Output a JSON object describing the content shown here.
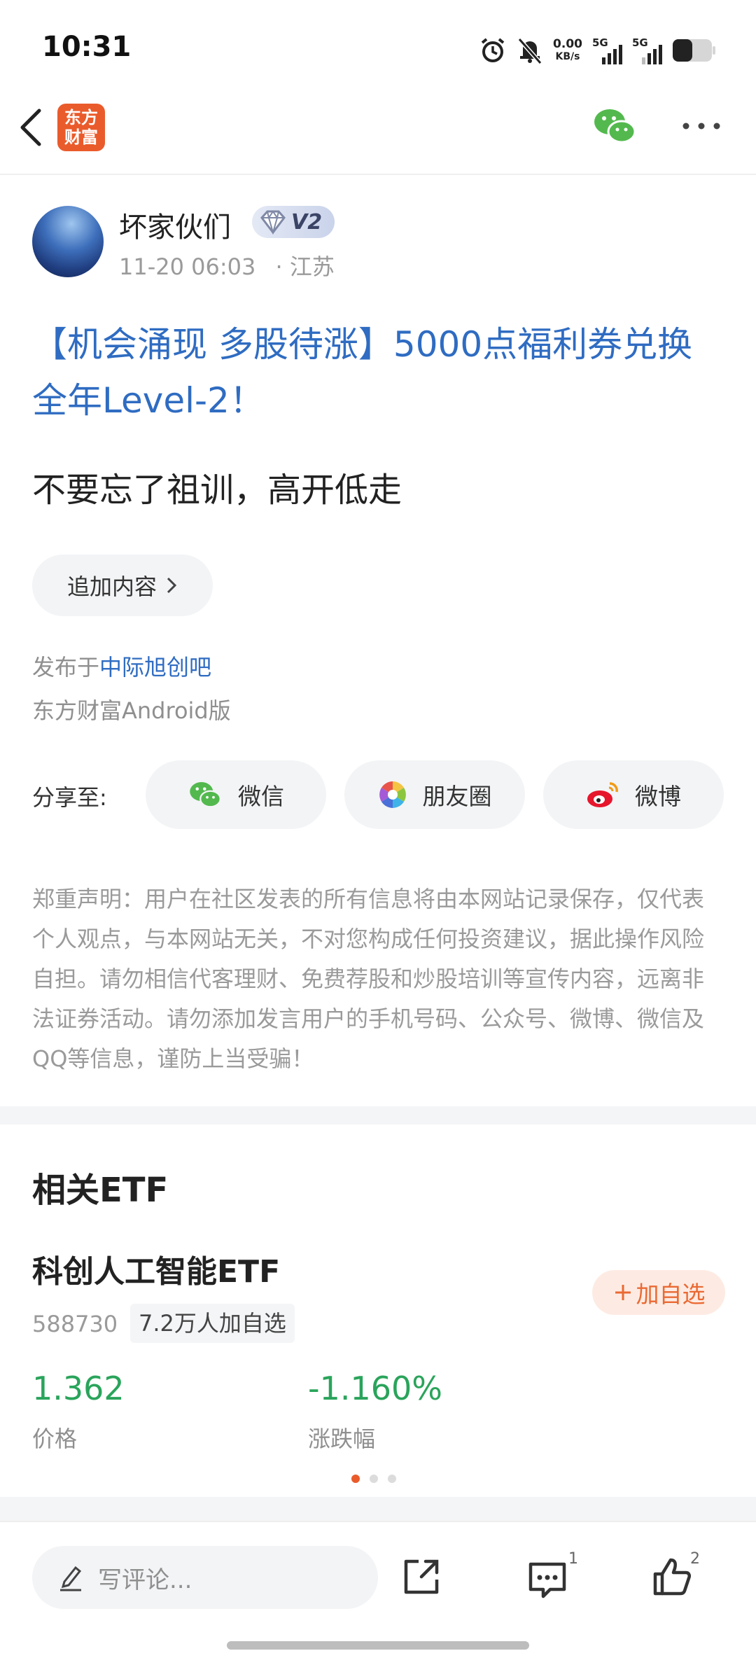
{
  "status_bar": {
    "time": "10:31",
    "net_speed_value": "0.00",
    "net_speed_unit": "KB/s",
    "signal1": "5G",
    "signal2": "5G"
  },
  "header": {
    "logo_text": "东方\n财富"
  },
  "post": {
    "author": "坏家伙们",
    "badge_level": "V2",
    "timestamp": "11-20 06:03",
    "location": "· 江苏",
    "title": "【机会涌现 多股待涨】5000点福利券兑换全年Level-2！",
    "body": "不要忘了祖训，高开低走",
    "append_label": "追加内容",
    "published_prefix": "发布于",
    "forum": "中际旭创吧",
    "client": "东方财富Android版"
  },
  "share": {
    "label": "分享至:",
    "options": [
      {
        "label": "微信",
        "icon": "wechat-icon"
      },
      {
        "label": "朋友圈",
        "icon": "moments-icon"
      },
      {
        "label": "微博",
        "icon": "weibo-icon"
      }
    ]
  },
  "disclaimer": "郑重声明：用户在社区发表的所有信息将由本网站记录保存，仅代表个人观点，与本网站无关，不对您构成任何投资建议，据此操作风险自担。请勿相信代客理财、免费荐股和炒股培训等宣传内容，远离非法证券活动。请勿添加发言用户的手机号码、公众号、微博、微信及QQ等信息，谨防上当受骗！",
  "etf": {
    "section_title": "相关ETF",
    "name": "科创人工智能ETF",
    "code": "588730",
    "followers": "7.2万人加自选",
    "add_label": "加自选",
    "price": "1.362",
    "price_label": "价格",
    "change": "-1.160%",
    "change_label": "涨跌幅",
    "page_indicator": {
      "total": 3,
      "active": 0
    },
    "colors": {
      "down": "#2aa45b",
      "accent": "#ea6a33"
    }
  },
  "bottom_bar": {
    "comment_placeholder": "写评论...",
    "comment_count": "1",
    "like_count": "2"
  }
}
